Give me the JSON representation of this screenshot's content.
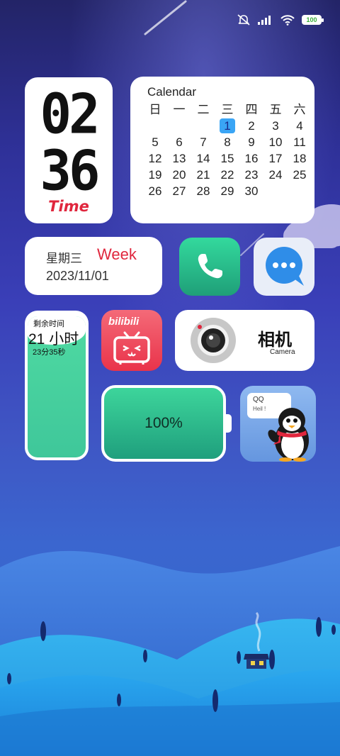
{
  "status_bar": {
    "icons": [
      "mute-icon",
      "signal-icon",
      "wifi-icon",
      "battery-icon"
    ],
    "battery_text": "100"
  },
  "clock": {
    "hour": "02",
    "minute": "36",
    "label": "Time"
  },
  "calendar": {
    "title": "Calendar",
    "weekdays": [
      "日",
      "一",
      "二",
      "三",
      "四",
      "五",
      "六"
    ],
    "leading_blanks": 3,
    "days": [
      "1",
      "2",
      "3",
      "4",
      "5",
      "6",
      "7",
      "8",
      "9",
      "10",
      "11",
      "12",
      "13",
      "14",
      "15",
      "16",
      "17",
      "18",
      "19",
      "20",
      "21",
      "22",
      "23",
      "24",
      "25",
      "26",
      "27",
      "28",
      "29",
      "30"
    ],
    "today": "1",
    "highlight_color": "#3aa5f5"
  },
  "week": {
    "weekday_cn": "星期三",
    "label_en": "Week",
    "date": "2023/11/01"
  },
  "apps": {
    "phone": {
      "icon": "phone-icon"
    },
    "messages": {
      "icon": "chat-bubble-icon"
    },
    "bilibili": {
      "logo_text": "bilibili",
      "icon": "tv-face-icon"
    }
  },
  "camera": {
    "title_cn": "相机",
    "title_en": "Camera",
    "icon": "camera-lens-icon"
  },
  "remaining_time": {
    "label": "剩余时间",
    "hours": "21 小时",
    "minutes_seconds": "23分35秒"
  },
  "battery_widget": {
    "percent_text": "100%",
    "level": 1.0
  },
  "qq": {
    "bubble_title": "QQ",
    "bubble_text": "Heil !",
    "icon": "penguin-icon"
  },
  "colors": {
    "accent_red": "#e0263d",
    "green": "#33d99d",
    "sky_top": "#232467",
    "sky_bottom": "#2b63c9"
  }
}
